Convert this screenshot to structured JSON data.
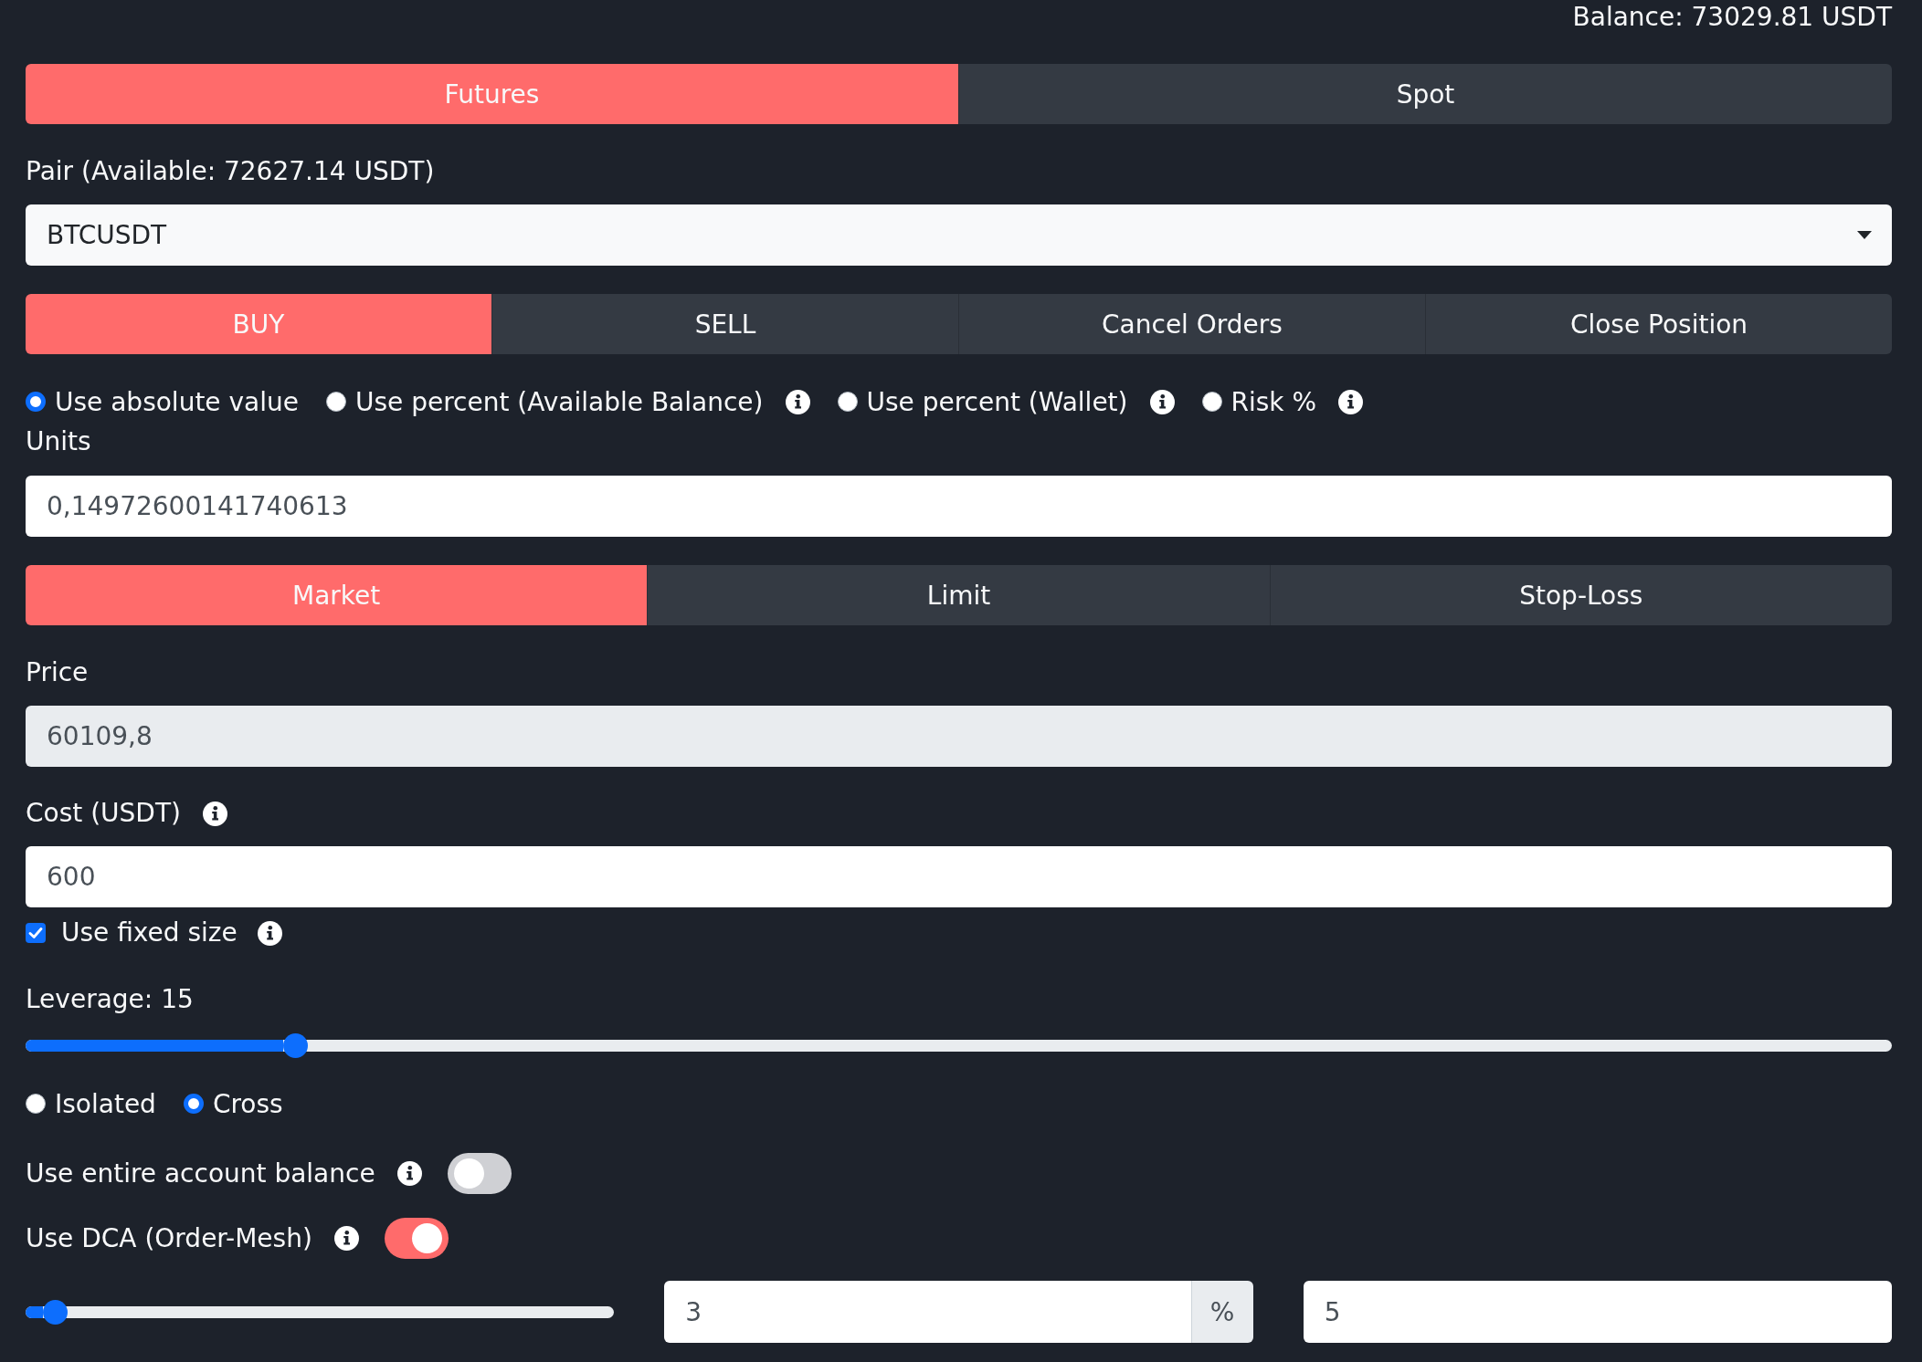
{
  "balance": "Balance: 73029.81 USDT",
  "market_tabs": [
    {
      "label": "Futures",
      "selected": true
    },
    {
      "label": "Spot",
      "selected": false
    }
  ],
  "pair": {
    "label": "Pair (Available: 72627.14 USDT)",
    "value": "BTCUSDT"
  },
  "action_tabs": [
    {
      "label": "BUY",
      "selected": true
    },
    {
      "label": "SELL",
      "selected": false
    },
    {
      "label": "Cancel Orders",
      "selected": false
    },
    {
      "label": "Close Position",
      "selected": false
    }
  ],
  "size_modes": [
    {
      "label": "Use absolute value",
      "selected": true,
      "info": false
    },
    {
      "label": "Use percent (Available Balance)",
      "selected": false,
      "info": true
    },
    {
      "label": "Use percent (Wallet)",
      "selected": false,
      "info": true
    },
    {
      "label": "Risk %",
      "selected": false,
      "info": true
    }
  ],
  "units": {
    "label": "Units",
    "value": "0,14972600141740613"
  },
  "order_types": [
    {
      "label": "Market",
      "selected": true
    },
    {
      "label": "Limit",
      "selected": false
    },
    {
      "label": "Stop-Loss",
      "selected": false
    }
  ],
  "price": {
    "label": "Price",
    "value": "60109,8",
    "disabled": true
  },
  "cost": {
    "label": "Cost (USDT)",
    "value": "600",
    "info": true
  },
  "fixed_size": {
    "label": "Use fixed size",
    "checked": true,
    "info": true
  },
  "leverage": {
    "label": "Leverage: 15",
    "level": 0.14
  },
  "margin_modes": [
    {
      "label": "Isolated",
      "selected": false
    },
    {
      "label": "Cross",
      "selected": true
    }
  ],
  "toggles": [
    {
      "label": "Use entire account balance",
      "on": false,
      "info": true
    },
    {
      "label": "Use DCA (Order-Mesh)",
      "on": true,
      "info": true
    }
  ],
  "dca": {
    "level": 0.03,
    "percent": {
      "value": "3",
      "unit": "%"
    },
    "count": {
      "value": "5"
    }
  }
}
